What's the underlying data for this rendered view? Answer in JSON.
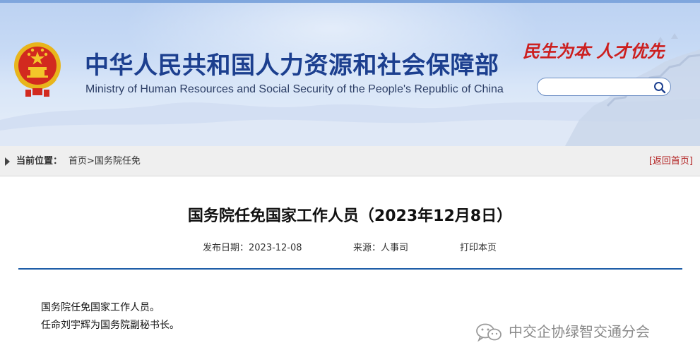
{
  "header": {
    "title_cn": "中华人民共和国人力资源和社会保障部",
    "title_en": "Ministry of Human Resources and Social Security of the People's Republic of China",
    "slogan": "民生为本 人才优先",
    "search": {
      "placeholder": ""
    }
  },
  "breadcrumb": {
    "label": "当前位置：",
    "home": "首页",
    "separator": ">",
    "current": "国务院任免",
    "back_link": "[返回首页]"
  },
  "article": {
    "title": "国务院任免国家工作人员（2023年12月8日）",
    "meta": {
      "date_label": "发布日期：",
      "date": "2023-12-08",
      "source_label": "来源：",
      "source": "人事司",
      "print": "打印本页"
    },
    "paragraphs": [
      "国务院任免国家工作人员。",
      "任命刘宇辉为国务院副秘书长。"
    ]
  },
  "watermark": {
    "text": "中交企协绿智交通分会"
  },
  "colors": {
    "title_blue": "#1c3f8f",
    "slogan_red": "#cc1f1f",
    "divider_blue": "#1f5ea8",
    "back_link_red": "#b22020"
  }
}
